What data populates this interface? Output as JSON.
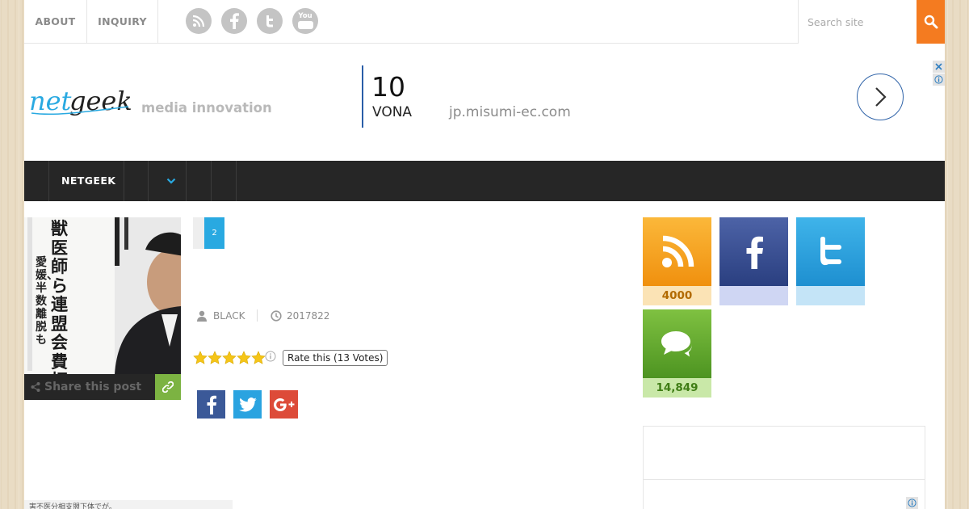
{
  "topbar": {
    "links": [
      "ABOUT",
      "INQUIRY"
    ],
    "social_icons": [
      "rss-icon",
      "facebook-icon",
      "twitter-icon",
      "youtube-icon"
    ],
    "youtube_label": "You",
    "search_placeholder": "Search site",
    "accent_color": "#f47b20"
  },
  "header": {
    "logo_text_a": "net",
    "logo_text_b": "geek",
    "tagline": "media innovation"
  },
  "ad": {
    "number": "10",
    "name": "VONA",
    "domain": "jp.misumi-ec.com"
  },
  "nav": {
    "items": [
      "NETGEEK"
    ],
    "dropdown_icon": "chevron-down-icon",
    "accent_color": "#29a9e1"
  },
  "article": {
    "thumb_headline": "獣医師ら連盟会費拒否",
    "thumb_subline": "愛媛、半数離脱も",
    "share_label": "Share this post",
    "page_number": "2",
    "author": "BLACK",
    "date": "2017822",
    "rating_stars": 5,
    "rating_label": "Rate this (13 Votes)",
    "bottom_strip_text": "害不医分相支盟下体でが。"
  },
  "sidebar": {
    "widgets": [
      {
        "icon": "rss-icon",
        "count": "4000",
        "color": "#f39c12"
      },
      {
        "icon": "facebook-icon",
        "count": "",
        "color": "#3b5998"
      },
      {
        "icon": "twitter-icon",
        "count": "",
        "color": "#2aa3e0"
      },
      {
        "icon": "comments-icon",
        "count": "14,849",
        "color": "#6aa82e"
      }
    ]
  }
}
